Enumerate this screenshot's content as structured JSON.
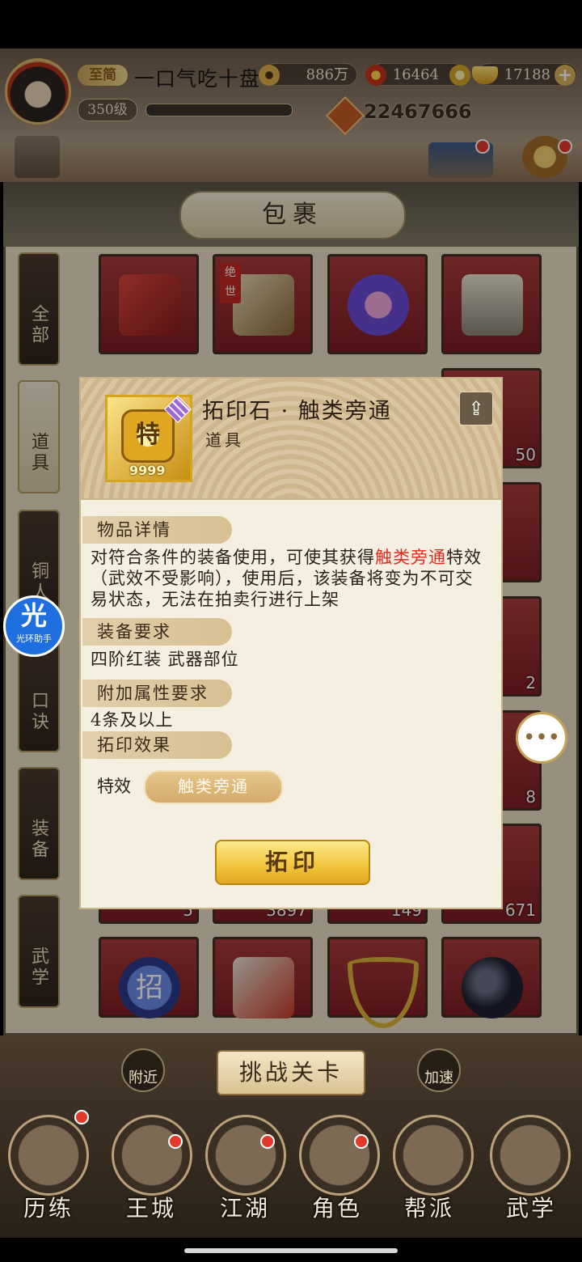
{
  "player": {
    "vip_label": "至简",
    "name": "一口气吃十盘",
    "level": "350级",
    "xp_fraction": 0.0,
    "power": "22467666"
  },
  "currencies": [
    {
      "icon": "copper-coin-icon",
      "value": "886万"
    },
    {
      "icon": "flame-token-icon",
      "value": "16464"
    },
    {
      "icon": "gold-ingot-icon",
      "value": "17188"
    }
  ],
  "panel": {
    "title": "包裹",
    "side_tabs": [
      "全部",
      "道具",
      "铜人",
      "口诀",
      "装备",
      "武学"
    ],
    "active_tab": "道具",
    "slot_counts": {
      "row2_col4": "50",
      "row4_col4": "2",
      "row5_col4": "8",
      "row6_col1": "5",
      "row6_col2": "3897",
      "row6_col3": "149",
      "row6_col4": "671"
    },
    "slot_badge": "绝世",
    "slot_glyph": "招"
  },
  "popup": {
    "item_name": "拓印石 · 触类旁通",
    "item_type": "道具",
    "item_glyph": "特",
    "item_quantity": "9999",
    "section_details": "物品详情",
    "details_text_prefix": "对符合条件的装备使用，可使其获得",
    "details_text_highlight": "触类旁通",
    "details_text_suffix": "特效（武效不受影响），使用后，该装备将变为不可交易状态，无法在拍卖行进行上架",
    "section_equip_req": "装备要求",
    "equip_req_text": "四阶红装  武器部位",
    "section_attr_req": "附加属性要求",
    "attr_req_text": "4条及以上",
    "section_effect": "拓印效果",
    "effect_label": "特效",
    "effect_value": "触类旁通",
    "action_button": "拓印"
  },
  "assistant": {
    "glyph": "光",
    "label": "光环助手"
  },
  "bottom": {
    "challenge_button": "挑战关卡",
    "left_round": "附近",
    "right_round": "加速",
    "nav": [
      "历练",
      "王城",
      "江湖",
      "角色",
      "帮派",
      "武学"
    ]
  },
  "colors": {
    "highlight_red": "#e22a1e",
    "gold_button": "#f2c43c",
    "slot_red": "#a8393b"
  }
}
